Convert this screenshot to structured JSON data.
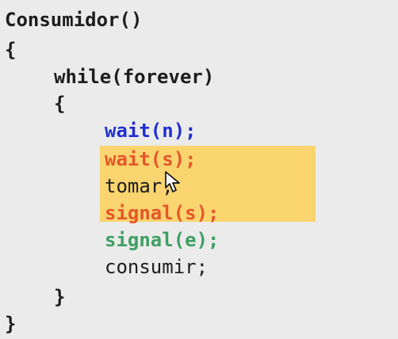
{
  "code": {
    "header": "Consumidor()",
    "open_brace": "{",
    "while_line": "while(forever)",
    "while_open": "{",
    "wait_n": "wait(n);",
    "wait_s": "wait(s);",
    "tomar": "tomar;",
    "signal_s": "signal(s);",
    "signal_e": "signal(e);",
    "consumir": "consumir;",
    "while_close": "}",
    "close_brace": "}"
  },
  "colors": {
    "background": "#ebebeb",
    "text": "#1d1d1d",
    "wait_n": "#1f2fd1",
    "critical": "#e5562a",
    "signal_e": "#3f9f63",
    "highlight": "#f9d46f"
  },
  "icons": {
    "pointer": "mouse-pointer-icon"
  }
}
